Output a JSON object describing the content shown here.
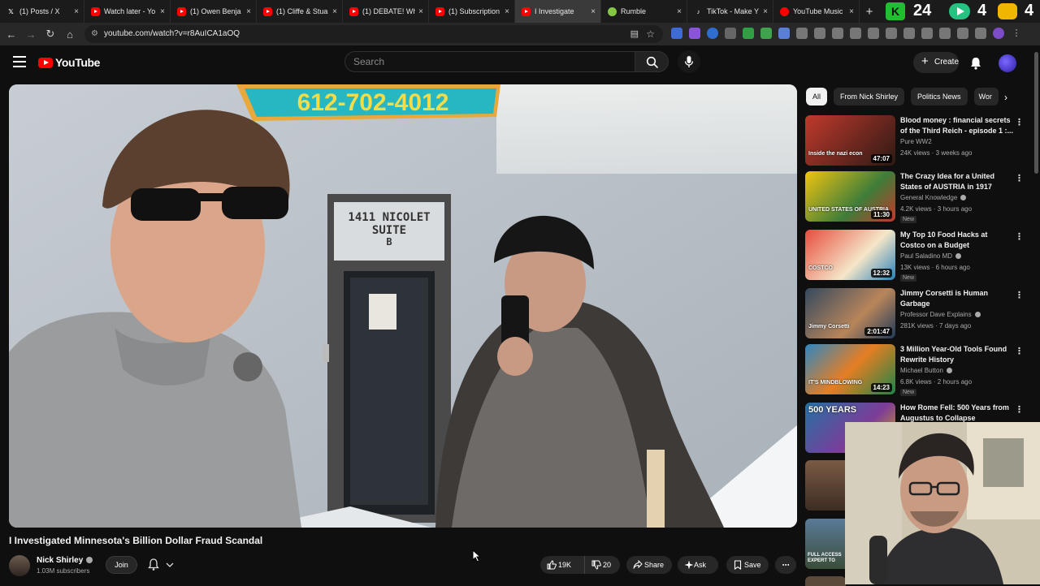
{
  "browser": {
    "tabs": [
      {
        "title": "(1) Posts / X",
        "icon": "x-icon",
        "fav": "x"
      },
      {
        "title": "Watch later - Yo",
        "icon": "youtube-icon",
        "fav": "yt"
      },
      {
        "title": "(1) Owen Benja",
        "icon": "youtube-icon",
        "fav": "yt"
      },
      {
        "title": "(1) Cliffe & Stua",
        "icon": "youtube-icon",
        "fav": "yt"
      },
      {
        "title": "(1) DEBATE! Wh",
        "icon": "youtube-icon",
        "fav": "yt"
      },
      {
        "title": "(1) Subscription",
        "icon": "youtube-icon",
        "fav": "yt"
      },
      {
        "title": "I Investigate",
        "icon": "youtube-icon",
        "fav": "yt",
        "active": true
      },
      {
        "title": "Rumble",
        "icon": "rumble-icon",
        "fav": "rumble"
      },
      {
        "title": "TikTok - Make Y",
        "icon": "tiktok-icon",
        "fav": "tt"
      },
      {
        "title": "YouTube Music",
        "icon": "youtube-music-icon",
        "fav": "ytm"
      }
    ],
    "overlay_numbers": [
      "24",
      "4",
      "4"
    ],
    "url": "youtube.com/watch?v=r8AuICA1aOQ"
  },
  "masthead": {
    "logo_text": "YouTube",
    "search_placeholder": "Search",
    "create_label": "Create"
  },
  "video": {
    "title": "I Investigated Minnesota's Billion Dollar Fraud Scandal",
    "scene_sign_phone": "612-702-4012",
    "scene_door_line1": "1411 NICOLET",
    "scene_door_line2": "SUITE",
    "scene_door_line3": "B",
    "channel_name": "Nick Shirley",
    "subscribers": "1.03M subscribers",
    "join_label": "Join",
    "likes": "19K",
    "dislikes": "20",
    "share_label": "Share",
    "ask_label": "Ask",
    "save_label": "Save"
  },
  "chips": [
    "All",
    "From Nick Shirley",
    "Politics News",
    "Wor"
  ],
  "recommendations": [
    {
      "title": "Blood money : financial secrets of the Third Reich - episode 1 :...",
      "channel": "Pure WW2",
      "meta": "24K views · 3 weeks ago",
      "duration": "47:07",
      "thumb_text": "Inside the nazi econ",
      "new": false,
      "verified": false
    },
    {
      "title": "The Crazy Idea for a United States of AUSTRIA in 1917",
      "channel": "General Knowledge",
      "meta": "4.2K views · 3 hours ago",
      "duration": "11:30",
      "thumb_text": "UNITED STATES OF AUSTRIA",
      "new": true,
      "verified": true
    },
    {
      "title": "My Top 10 Food Hacks at Costco on a Budget",
      "channel": "Paul Saladino MD",
      "meta": "13K views · 6 hours ago",
      "duration": "12:32",
      "thumb_text": "COSTCO",
      "new": true,
      "verified": true
    },
    {
      "title": "Jimmy Corsetti is Human Garbage",
      "channel": "Professor Dave Explains",
      "meta": "281K views · 7 days ago",
      "duration": "2:01:47",
      "thumb_text": "Jimmy Corsetti",
      "new": false,
      "verified": true
    },
    {
      "title": "3 Million Year-Old Tools Found Rewrite History",
      "channel": "Michael Button",
      "meta": "6.8K views · 2 hours ago",
      "duration": "14:23",
      "thumb_text": "IT'S MINDBLOWING",
      "new": true,
      "verified": true
    },
    {
      "title": "How Rome Fell: 500 Years from Augustus to Collapse",
      "channel": "",
      "meta": "",
      "duration": "",
      "thumb_text": "500 YEARS",
      "new": false,
      "verified": false
    }
  ],
  "partial_thumb_text": [
    "FULL ACCESS",
    "EXPERT TO"
  ],
  "colors": {
    "accent": "#ff0000",
    "background": "#0f0f0f",
    "chip_selected": "#f1f1f1"
  }
}
